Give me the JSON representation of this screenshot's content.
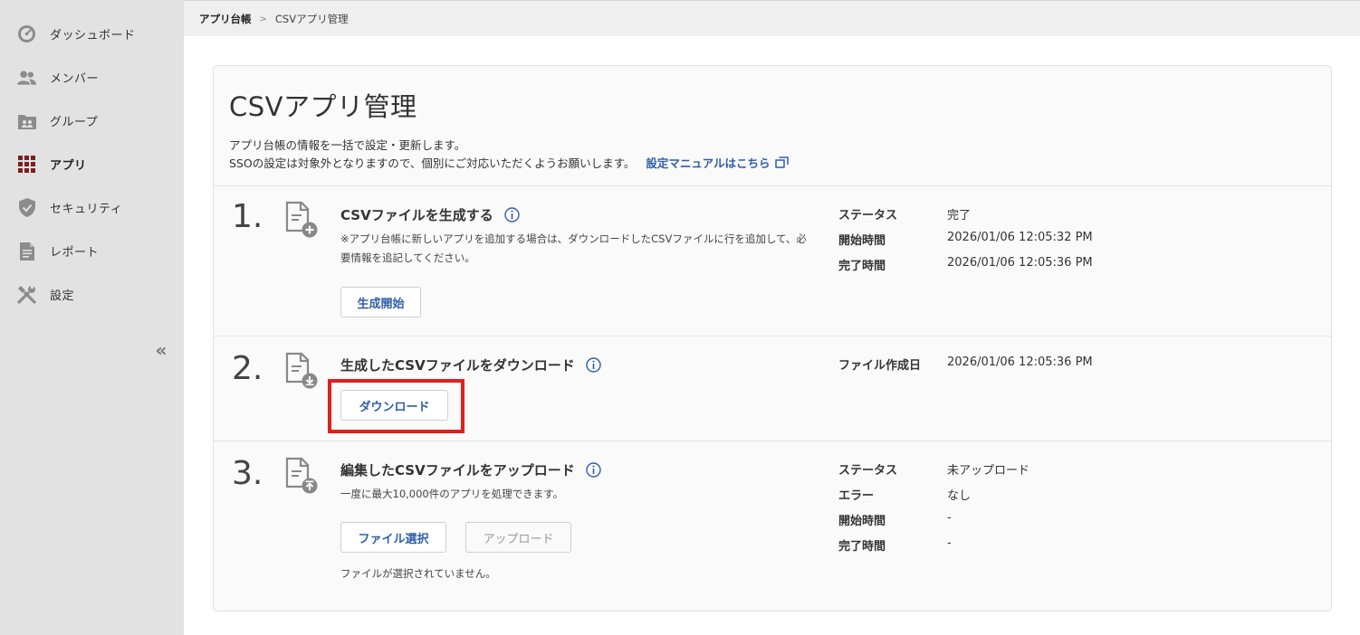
{
  "sidebar": {
    "items": [
      {
        "label": "ダッシュボード",
        "icon": "dashboard-gauge-icon"
      },
      {
        "label": "メンバー",
        "icon": "members-icon"
      },
      {
        "label": "グループ",
        "icon": "group-folder-icon"
      },
      {
        "label": "アプリ",
        "icon": "apps-grid-icon",
        "active": true
      },
      {
        "label": "セキュリティ",
        "icon": "shield-check-icon"
      },
      {
        "label": "レポート",
        "icon": "report-document-icon"
      },
      {
        "label": "設定",
        "icon": "settings-tools-icon"
      }
    ],
    "collapse": "«"
  },
  "breadcrumb": {
    "parent": "アプリ台帳",
    "separator": ">",
    "current": "CSVアプリ管理"
  },
  "page": {
    "title": "CSVアプリ管理",
    "description_line1": "アプリ台帳の情報を一括で設定・更新します。",
    "description_line2": "SSOの設定は対象外となりますので、個別にご対応いただくようお願いします。",
    "manual_link": "設定マニュアルはこちら"
  },
  "steps": [
    {
      "number": "1.",
      "title": "CSVファイルを生成する",
      "note": "※アプリ台帳に新しいアプリを追加する場合は、ダウンロードしたCSVファイルに行を追加して、必要情報を追記してください。",
      "button": "生成開始",
      "fields": [
        {
          "label": "ステータス",
          "value": "完了"
        },
        {
          "label": "開始時間",
          "value": "2026/01/06 12:05:32 PM"
        },
        {
          "label": "完了時間",
          "value": "2026/01/06 12:05:36 PM"
        }
      ]
    },
    {
      "number": "2.",
      "title": "生成したCSVファイルをダウンロード",
      "button": "ダウンロード",
      "fields": [
        {
          "label": "ファイル作成日",
          "value": "2026/01/06 12:05:36 PM"
        }
      ]
    },
    {
      "number": "3.",
      "title": "編集したCSVファイルをアップロード",
      "note": "一度に最大10,000件のアプリを処理できます。",
      "button_select": "ファイル選択",
      "button_upload": "アップロード",
      "file_status": "ファイルが選択されていません。",
      "fields": [
        {
          "label": "ステータス",
          "value": "未アップロード"
        },
        {
          "label": "エラー",
          "value": "なし"
        },
        {
          "label": "開始時間",
          "value": "-"
        },
        {
          "label": "完了時間",
          "value": "-"
        }
      ]
    }
  ],
  "colors": {
    "accent": "#2f5ea8",
    "active_icon": "#7b1f1f",
    "highlight": "#e0201f"
  }
}
